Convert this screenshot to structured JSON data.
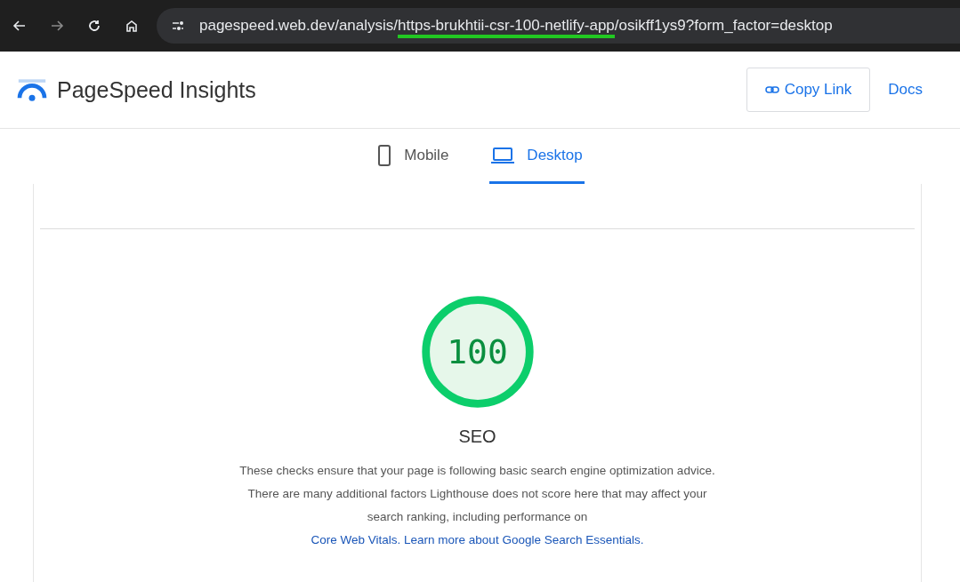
{
  "browser": {
    "url_parts": [
      {
        "text": "pagespeed.web.dev/analysis/",
        "underlined": false
      },
      {
        "text": "https-brukhtii-csr-100-netlify-app",
        "underlined": true
      },
      {
        "text": "/osikff1ys9?form_factor=desktop",
        "underlined": false
      }
    ]
  },
  "header": {
    "title": "PageSpeed Insights",
    "copy_link": "Copy Link",
    "docs": "Docs"
  },
  "tabs": [
    {
      "label": "Mobile",
      "kind": "phone",
      "selected": false
    },
    {
      "label": "Desktop",
      "kind": "laptop",
      "selected": true
    }
  ],
  "score": {
    "value": "100",
    "level": 1,
    "category": "SEO",
    "description": "These checks ensure that your page is following basic search engine optimization advice. There are many additional factors Lighthouse does not score here that may affect your search ranking, including performance on",
    "links": [
      "Core Web Vitals.",
      "Learn more about Google Search Essentials."
    ]
  }
}
